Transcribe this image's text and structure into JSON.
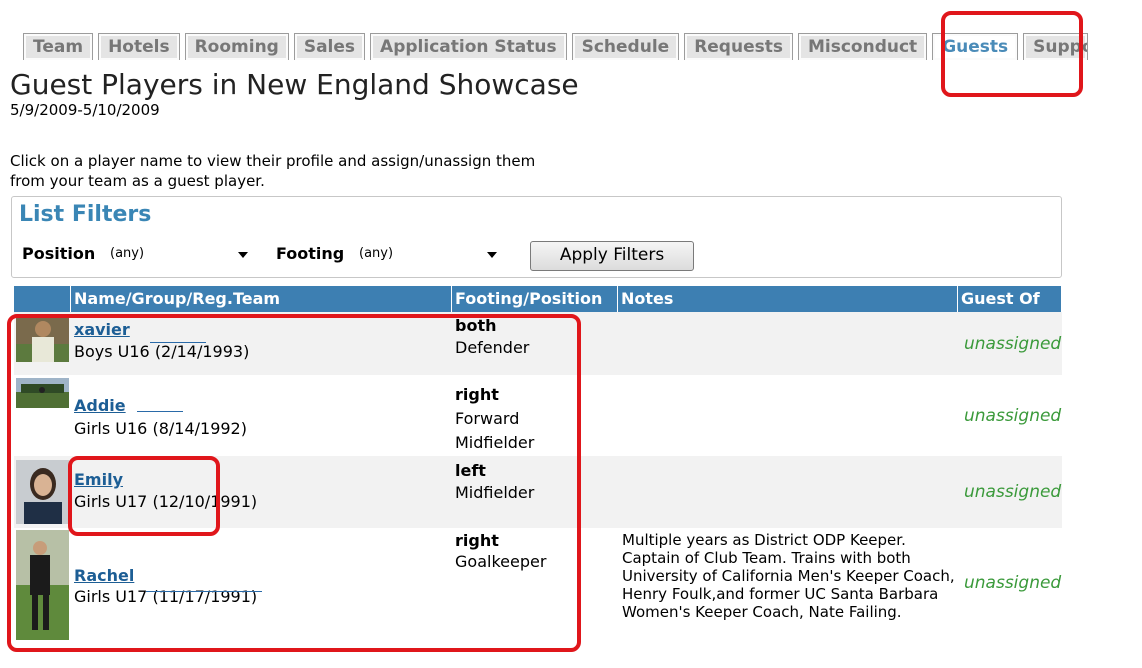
{
  "tabs": [
    "Team",
    "Hotels",
    "Rooming",
    "Sales",
    "Application Status",
    "Schedule",
    "Requests",
    "Misconduct",
    "Guests",
    "Suppo"
  ],
  "active_tab": "Guests",
  "page": {
    "title": "Guest Players in New England Showcase",
    "dates": "5/9/2009-5/10/2009",
    "instructions_line1": "Click on a player name to view their profile and assign/unassign them",
    "instructions_line2": "from your team as a guest player."
  },
  "filters": {
    "title": "List Filters",
    "position_label": "Position",
    "position_value": "(any)",
    "footing_label": "Footing",
    "footing_value": "(any)",
    "apply_label": "Apply Filters"
  },
  "table": {
    "headers": [
      "",
      "Name/Group/Reg.Team",
      "Footing/Position",
      "Notes",
      "Guest Of"
    ],
    "rows": [
      {
        "name": "xavier",
        "group": "Boys U16 (2/14/1993)",
        "footing": "both",
        "positions": [
          "Defender"
        ],
        "notes": "",
        "guest_of": "unassigned"
      },
      {
        "name": "Addie",
        "group": "Girls U16 (8/14/1992)",
        "footing": "right",
        "positions": [
          "Forward",
          "Midfielder"
        ],
        "notes": "",
        "guest_of": "unassigned"
      },
      {
        "name": "Emily",
        "group": "Girls U17 (12/10/1991)",
        "footing": "left",
        "positions": [
          "Midfielder"
        ],
        "notes": "",
        "guest_of": "unassigned"
      },
      {
        "name": "Rachel",
        "group": "Girls U17 (11/17/1991)",
        "footing": "right",
        "positions": [
          "Goalkeeper"
        ],
        "notes": "Multiple years as District ODP Keeper. Captain of Club Team. Trains with both University of California Men's Keeper Coach, Henry Foulk,and former UC Santa Barbara Women's Keeper Coach, Nate Failing.",
        "guest_of": "unassigned"
      }
    ]
  },
  "colors": {
    "header_bg": "#3d7fb2",
    "link": "#1d5e95",
    "assigned_status": "#3b9a3b",
    "annotation": "#e0161b"
  }
}
